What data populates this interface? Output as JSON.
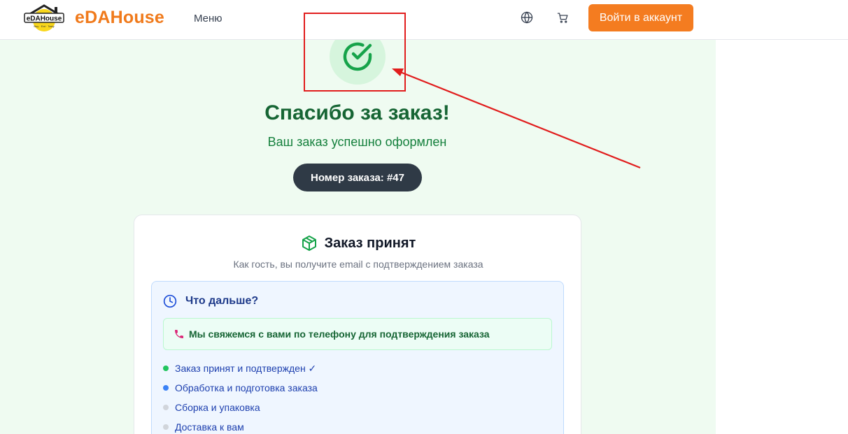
{
  "header": {
    "brand": "eDAHouse",
    "logo_text": "eDAHouse",
    "menu_label": "Меню",
    "login_label": "Войти в аккаунт",
    "accent_color": "#f47c20"
  },
  "success": {
    "title": "Спасибо за заказ!",
    "subtitle": "Ваш заказ успешно оформлен",
    "order_number": "Номер заказа: #47",
    "icon": "check-circle-icon"
  },
  "card": {
    "title": "Заказ принят",
    "subtitle": "Как гость, вы получите email с подтверждением заказа",
    "next": {
      "title": "Что дальше?",
      "phone_notice": "Мы свяжемся с вами по телефону для подтверждения заказа",
      "steps": [
        {
          "label": "Заказ принят и подтвержден ✓",
          "status_color": "#22c55e"
        },
        {
          "label": "Обработка и подготовка заказа",
          "status_color": "#3b82f6"
        },
        {
          "label": "Сборка и упаковка",
          "status_color": "#d1d5db"
        },
        {
          "label": "Доставка к вам",
          "status_color": "#d1d5db"
        }
      ]
    }
  },
  "annotation_color": "#e11d1d"
}
